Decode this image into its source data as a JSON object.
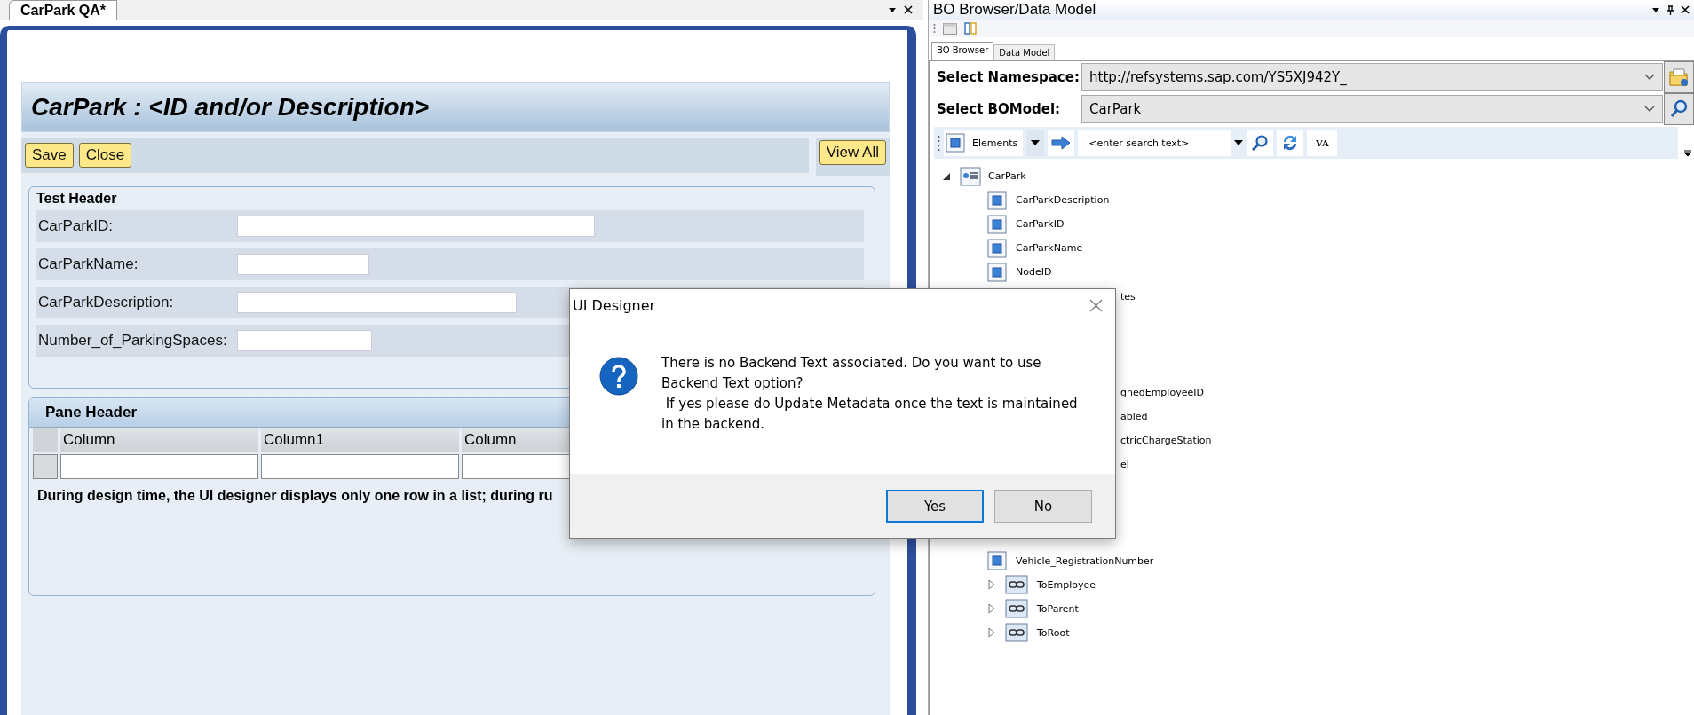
{
  "editor": {
    "tab": "CarPark QA*",
    "form_title": "CarPark : <ID and/or Description>",
    "toolbar_buttons": [
      "Save",
      "Close"
    ],
    "view_all": "View All",
    "section": {
      "title": "Test Header",
      "fields": [
        {
          "label": "CarParkID:"
        },
        {
          "label": "CarParkName:"
        },
        {
          "label": "CarParkDescription:"
        },
        {
          "label": "Number_of_ParkingSpaces:"
        }
      ]
    },
    "pane": {
      "title": "Pane Header",
      "columns": [
        "Column",
        "Column1",
        "Column"
      ],
      "note": "During design time, the UI designer displays only one row in a list; during ru"
    }
  },
  "bo_browser": {
    "title": "BO Browser/Data Model",
    "tabs": [
      {
        "label": "BO Browser",
        "selected": true
      },
      {
        "label": "Data Model",
        "selected": false
      }
    ],
    "namespace": {
      "label": "Select Namespace:",
      "value": "http://refsystems.sap.com/YS5XJ942Y_"
    },
    "bomodel": {
      "label": "Select BOModel:",
      "value": "CarPark"
    },
    "toolbar": {
      "filter": "Elements",
      "search": {
        "placeholder": "<enter search text>"
      },
      "va": "VA"
    },
    "tree": [
      {
        "label": "CarPark",
        "kind": "root",
        "expanded": true,
        "children": [
          {
            "label": "CarParkDescription",
            "kind": "element"
          },
          {
            "label": "CarParkID",
            "kind": "element"
          },
          {
            "label": "CarParkName",
            "kind": "element"
          },
          {
            "label": "NodeID",
            "kind": "element"
          },
          {
            "label": "tes",
            "kind": "partial"
          },
          {
            "kind": "covered"
          },
          {
            "kind": "covered"
          },
          {
            "kind": "covered"
          },
          {
            "label": "gnedEmployeeID",
            "kind": "partial"
          },
          {
            "label": "abled",
            "kind": "partial"
          },
          {
            "label": "ctricChargeStation",
            "kind": "partial"
          },
          {
            "label": "el",
            "kind": "partial"
          },
          {
            "kind": "covered"
          },
          {
            "kind": "covered"
          },
          {
            "kind": "covered"
          },
          {
            "label": "Vehicle_RegistrationNumber",
            "kind": "element"
          },
          {
            "label": "ToEmployee",
            "kind": "association",
            "expanded": false
          },
          {
            "label": "ToParent",
            "kind": "association",
            "expanded": false
          },
          {
            "label": "ToRoot",
            "kind": "association",
            "expanded": false
          }
        ]
      }
    ]
  },
  "dialog": {
    "title": "UI Designer",
    "message": "There is no Backend Text associated. Do you want to use\nBackend Text option?\n If yes please do Update Metadata once the text is maintained\nin the backend.",
    "buttons": [
      {
        "label": "Yes",
        "default": true
      },
      {
        "label": "No",
        "default": false
      }
    ]
  }
}
